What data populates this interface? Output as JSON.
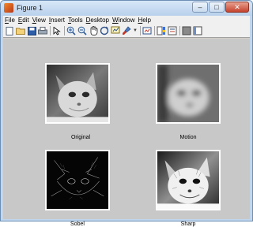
{
  "window": {
    "title": "Figure 1",
    "controls": {
      "minimize": "–",
      "maximize": "□",
      "close": "✕"
    }
  },
  "menu": [
    {
      "label": "File",
      "accel": "F",
      "rest": "ile"
    },
    {
      "label": "Edit",
      "accel": "E",
      "rest": "dit"
    },
    {
      "label": "View",
      "accel": "V",
      "rest": "iew"
    },
    {
      "label": "Insert",
      "accel": "I",
      "rest": "nsert"
    },
    {
      "label": "Tools",
      "accel": "T",
      "rest": "ools"
    },
    {
      "label": "Desktop",
      "accel": "D",
      "rest": "esktop"
    },
    {
      "label": "Window",
      "accel": "W",
      "rest": "indow"
    },
    {
      "label": "Help",
      "accel": "H",
      "rest": "elp"
    }
  ],
  "toolbar": {
    "icons": [
      "new-figure-icon",
      "open-file-icon",
      "save-icon",
      "print-icon",
      "edit-plot-icon",
      "zoom-in-icon",
      "zoom-out-icon",
      "pan-icon",
      "rotate-3d-icon",
      "data-cursor-icon",
      "brush-icon",
      "link-plot-icon",
      "insert-colorbar-icon",
      "insert-legend-icon",
      "hide-plot-tools-icon",
      "show-plot-tools-icon"
    ]
  },
  "subplots": [
    {
      "caption": "Original",
      "effect": "original"
    },
    {
      "caption": "Motion",
      "effect": "motion"
    },
    {
      "caption": "Sobel",
      "effect": "sobel"
    },
    {
      "caption": "Sharp",
      "effect": "sharp"
    }
  ],
  "colors": {
    "window_frame": "#bfd6ee",
    "figure_background": "#c8c8c8",
    "close_button": "#c5432e"
  }
}
